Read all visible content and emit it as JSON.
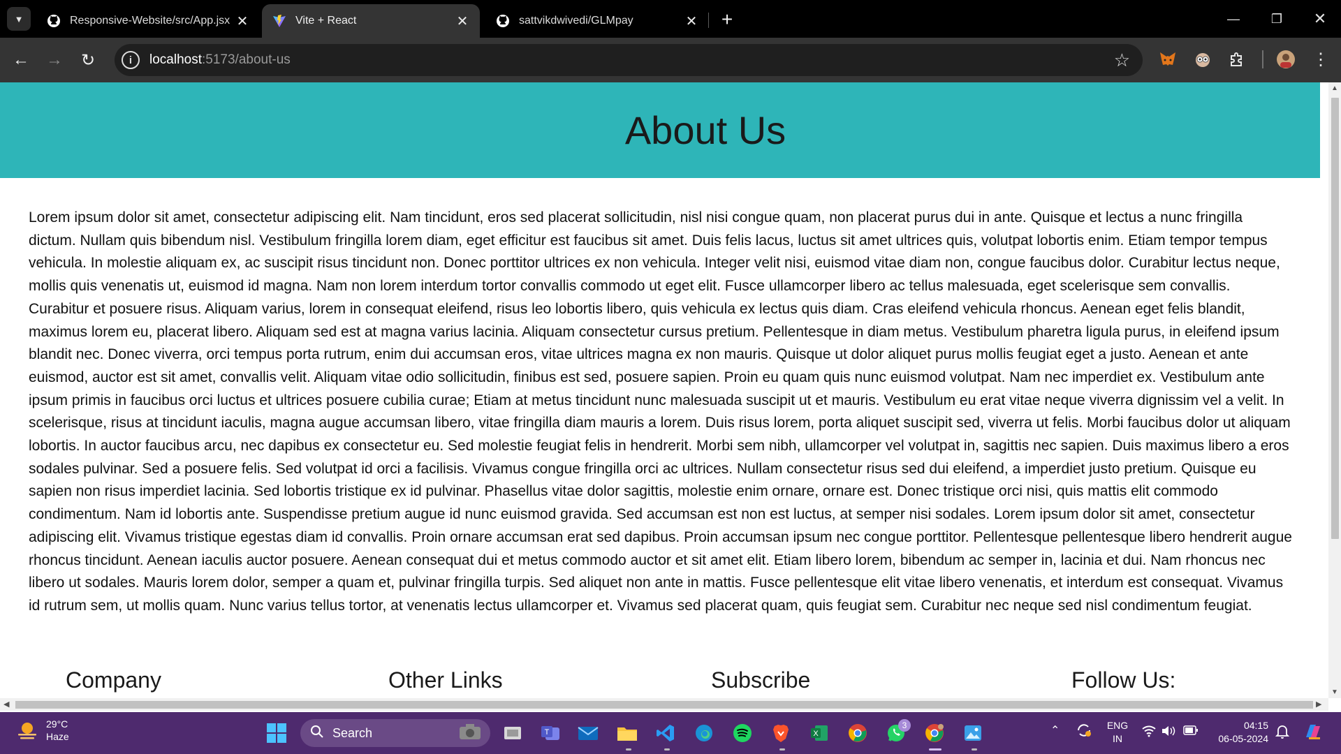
{
  "browser": {
    "tabs": [
      {
        "title": "Responsive-Website/src/App.jsx",
        "icon": "github-icon",
        "active": false
      },
      {
        "title": "Vite + React",
        "icon": "vite-icon",
        "active": true
      },
      {
        "title": "sattvikdwivedi/GLMpay",
        "icon": "github-icon",
        "active": false
      }
    ],
    "new_tab_label": "+",
    "url_host": "localhost",
    "url_rest": ":5173/about-us"
  },
  "page": {
    "heading": "About Us",
    "body_text": "Lorem ipsum dolor sit amet, consectetur adipiscing elit. Nam tincidunt, eros sed placerat sollicitudin, nisl nisi congue quam, non placerat purus dui in ante. Quisque et lectus a nunc fringilla dictum. Nullam quis bibendum nisl. Vestibulum fringilla lorem diam, eget efficitur est faucibus sit amet. Duis felis lacus, luctus sit amet ultrices quis, volutpat lobortis enim. Etiam tempor tempus vehicula. In molestie aliquam ex, ac suscipit risus tincidunt non. Donec porttitor ultrices ex non vehicula. Integer velit nisi, euismod vitae diam non, congue faucibus dolor. Curabitur lectus neque, mollis quis venenatis ut, euismod id magna. Nam non lorem interdum tortor convallis commodo ut eget elit. Fusce ullamcorper libero ac tellus malesuada, eget scelerisque sem convallis. Curabitur et posuere risus. Aliquam varius, lorem in consequat eleifend, risus leo lobortis libero, quis vehicula ex lectus quis diam. Cras eleifend vehicula rhoncus. Aenean eget felis blandit, maximus lorem eu, placerat libero. Aliquam sed est at magna varius lacinia. Aliquam consectetur cursus pretium. Pellentesque in diam metus. Vestibulum pharetra ligula purus, in eleifend ipsum blandit nec. Donec viverra, orci tempus porta rutrum, enim dui accumsan eros, vitae ultrices magna ex non mauris. Quisque ut dolor aliquet purus mollis feugiat eget a justo. Aenean et ante euismod, auctor est sit amet, convallis velit. Aliquam vitae odio sollicitudin, finibus est sed, posuere sapien. Proin eu quam quis nunc euismod volutpat. Nam nec imperdiet ex. Vestibulum ante ipsum primis in faucibus orci luctus et ultrices posuere cubilia curae; Etiam at metus tincidunt nunc malesuada suscipit ut et mauris. Vestibulum eu erat vitae neque viverra dignissim vel a velit. In scelerisque, risus at tincidunt iaculis, magna augue accumsan libero, vitae fringilla diam mauris a lorem. Duis risus lorem, porta aliquet suscipit sed, viverra ut felis. Morbi faucibus dolor ut aliquam lobortis. In auctor faucibus arcu, nec dapibus ex consectetur eu. Sed molestie feugiat felis in hendrerit. Morbi sem nibh, ullamcorper vel volutpat in, sagittis nec sapien. Duis maximus libero a eros sodales pulvinar. Sed a posuere felis. Sed volutpat id orci a facilisis. Vivamus congue fringilla orci ac ultrices. Nullam consectetur risus sed dui eleifend, a imperdiet justo pretium. Quisque eu sapien non risus imperdiet lacinia. Sed lobortis tristique ex id pulvinar. Phasellus vitae dolor sagittis, molestie enim ornare, ornare est. Donec tristique orci nisi, quis mattis elit commodo condimentum. Nam id lobortis ante. Suspendisse pretium augue id nunc euismod gravida. Sed accumsan est non est luctus, at semper nisi sodales. Lorem ipsum dolor sit amet, consectetur adipiscing elit. Vivamus tristique egestas diam id convallis. Proin ornare accumsan erat sed dapibus. Proin accumsan ipsum nec congue porttitor. Pellentesque pellentesque libero hendrerit augue rhoncus tincidunt. Aenean iaculis auctor posuere. Aenean consequat dui et metus commodo auctor et sit amet elit. Etiam libero lorem, bibendum ac semper in, lacinia et dui. Nam rhoncus nec libero ut sodales. Mauris lorem dolor, semper a quam et, pulvinar fringilla turpis. Sed aliquet non ante in mattis. Fusce pellentesque elit vitae libero venenatis, et interdum est consequat. Vivamus id rutrum sem, ut mollis quam. Nunc varius tellus tortor, at venenatis lectus ullamcorper et. Vivamus sed placerat quam, quis feugiat sem. Curabitur nec neque sed nisl condimentum feugiat.",
    "footer_headings": [
      "Company",
      "Other Links",
      "Subscribe",
      "Follow Us:"
    ],
    "colors": {
      "hero_bg": "#2eb5b8"
    }
  },
  "taskbar": {
    "weather_temp": "29°C",
    "weather_desc": "Haze",
    "search_label": "Search",
    "whatsapp_badge": "3",
    "lang_top": "ENG",
    "lang_bottom": "IN",
    "time": "04:15",
    "date": "06-05-2024"
  }
}
